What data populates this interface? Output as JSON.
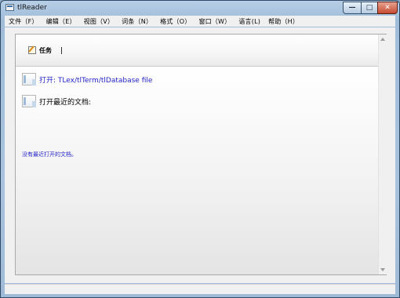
{
  "window": {
    "title": "tlReader"
  },
  "controls": {
    "minimize": "—",
    "maximize": "□",
    "close": "✕"
  },
  "menu": [
    "文件（F）",
    "编辑（E）",
    "视图（V）",
    "词条（N）",
    "格式（O）",
    "窗口（W）",
    "语言(L)",
    "帮助（H）"
  ],
  "tasks": {
    "label": "任务",
    "icon": "edit-task-icon"
  },
  "open_item": {
    "text": "打开: TLex/tlTerm/tlDatabase file",
    "icon": "document-icon"
  },
  "recent": {
    "heading": "打开最近的文档:",
    "empty_text": "没有最近打开的文档。",
    "icon": "document-icon"
  },
  "colors": {
    "link": "#2323c8",
    "frame": "#9fbcd9",
    "close": "#c64a31"
  }
}
